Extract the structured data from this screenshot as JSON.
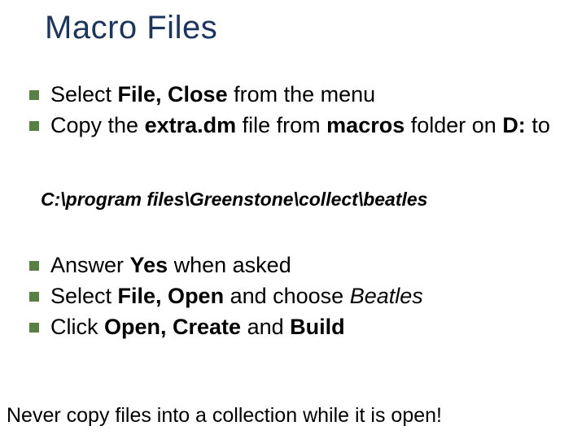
{
  "title": "Macro Files",
  "bullets1": {
    "b0": {
      "t0": "Select ",
      "t1": "File, Close",
      "t2": " from the menu"
    },
    "b1": {
      "t0": "Copy the ",
      "t1": "extra.dm",
      "t2": " file from ",
      "t3": "macros",
      "t4": " folder on ",
      "t5": "D:",
      "t6": " to"
    }
  },
  "path": "C:\\program files\\Greenstone\\collect\\beatles",
  "bullets2": {
    "b0": {
      "t0": "Answer ",
      "t1": "Yes",
      "t2": " when asked"
    },
    "b1": {
      "t0": "Select ",
      "t1": "File, Open",
      "t2": " and choose ",
      "t3": "Beatles"
    },
    "b2": {
      "t0": "Click ",
      "t1": "Open, Create",
      "t2": " and ",
      "t3": "Build"
    }
  },
  "footer": "Never copy files into a collection while it is open!"
}
